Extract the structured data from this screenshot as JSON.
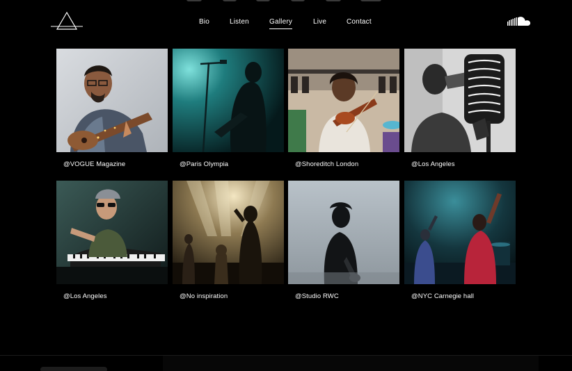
{
  "nav": {
    "items": [
      {
        "label": "Bio",
        "active": false
      },
      {
        "label": "Listen",
        "active": false
      },
      {
        "label": "Gallery",
        "active": true
      },
      {
        "label": "Live",
        "active": false
      },
      {
        "label": "Contact",
        "active": false
      }
    ]
  },
  "icons": {
    "logo": "triangle-logo-icon",
    "social": "soundcloud-icon"
  },
  "gallery": {
    "items": [
      {
        "caption": "@VOGUE Magazine",
        "photo": "musician-playing-guitar-photo"
      },
      {
        "caption": "@Paris Olympia",
        "photo": "singer-at-microphone-teal-stage-photo"
      },
      {
        "caption": "@Shoreditch London",
        "photo": "violinist-on-street-photo"
      },
      {
        "caption": "@Los Angeles",
        "photo": "singer-with-studio-microphone-bw-photo"
      },
      {
        "caption": "@Los Angeles",
        "photo": "pianist-pointing-at-camera-photo"
      },
      {
        "caption": "@No inspiration",
        "photo": "band-on-stage-warm-lights-photo"
      },
      {
        "caption": "@Studio RWC",
        "photo": "guitarist-silhouette-grey-photo"
      },
      {
        "caption": "@NYC Carnegie hall",
        "photo": "performers-on-blue-stage-photo"
      }
    ]
  },
  "colors": {
    "background": "#000000",
    "text": "#ffffff"
  }
}
